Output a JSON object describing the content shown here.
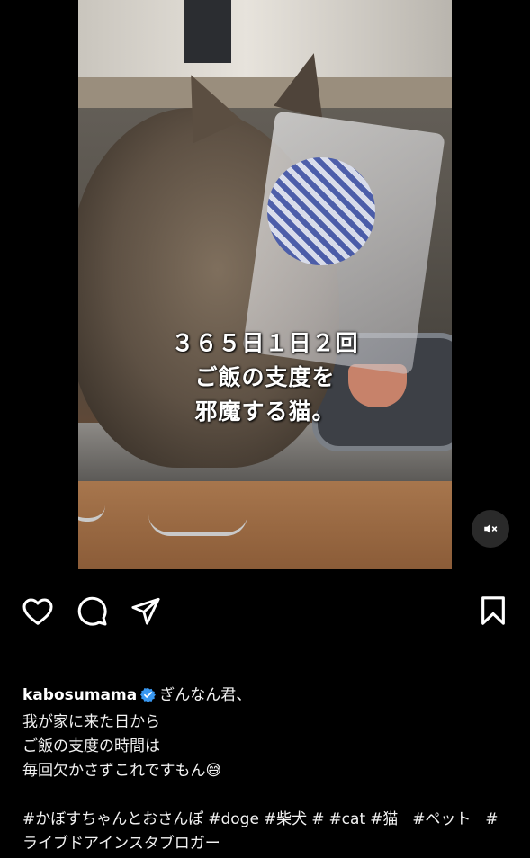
{
  "video": {
    "caption_lines": [
      "３６５日１日２回",
      "ご飯の支度を",
      "邪魔する猫。"
    ],
    "mute_icon": "speaker-muted-icon"
  },
  "actions": {
    "like_icon": "heart-icon",
    "comment_icon": "comment-icon",
    "share_icon": "send-icon",
    "save_icon": "bookmark-icon"
  },
  "post": {
    "username": "kabosumama",
    "verified_icon": "verified-badge-icon",
    "verified_color": "#3897f0",
    "caption_lines": [
      "ぎんなん君、",
      "我が家に来た日から",
      "ご飯の支度の時間は",
      "毎回欠かさずこれですもん😅"
    ],
    "hashtags": [
      "#かぼすちゃんとおさんぽ",
      "#doge",
      "#柴犬",
      "#",
      "#cat",
      "#猫",
      "#ペット",
      "#ライブドアインスタブロガー"
    ]
  }
}
